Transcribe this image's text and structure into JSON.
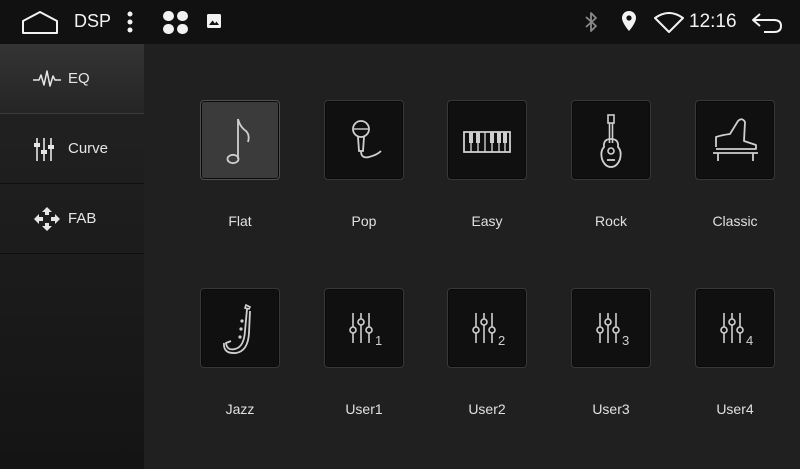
{
  "statusbar": {
    "title": "DSP",
    "time": "12:16",
    "icons": [
      "home-icon",
      "more-vert-icon",
      "apps-icon",
      "image-icon",
      "bluetooth-icon",
      "location-icon",
      "wifi-icon",
      "back-icon"
    ]
  },
  "sidebar": {
    "items": [
      {
        "label": "EQ",
        "icon": "waveform-icon",
        "active": true
      },
      {
        "label": "Curve",
        "icon": "sliders-icon",
        "active": false
      },
      {
        "label": "FAB",
        "icon": "balance-arrows-icon",
        "active": false
      }
    ]
  },
  "presets": {
    "items": [
      {
        "label": "Flat",
        "icon": "music-note-icon",
        "selected": true
      },
      {
        "label": "Pop",
        "icon": "microphone-icon",
        "selected": false
      },
      {
        "label": "Easy",
        "icon": "piano-keys-icon",
        "selected": false
      },
      {
        "label": "Rock",
        "icon": "guitar-icon",
        "selected": false
      },
      {
        "label": "Classic",
        "icon": "grand-piano-icon",
        "selected": false
      },
      {
        "label": "Jazz",
        "icon": "saxophone-icon",
        "selected": false
      },
      {
        "label": "User1",
        "icon": "user-eq-icon",
        "number": "1",
        "selected": false
      },
      {
        "label": "User2",
        "icon": "user-eq-icon",
        "number": "2",
        "selected": false
      },
      {
        "label": "User3",
        "icon": "user-eq-icon",
        "number": "3",
        "selected": false
      },
      {
        "label": "User4",
        "icon": "user-eq-icon",
        "number": "4",
        "selected": false
      }
    ]
  }
}
